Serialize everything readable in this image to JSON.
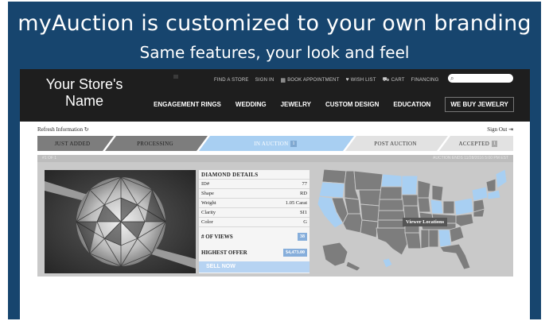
{
  "slide": {
    "headline": "myAuction is customized to your own branding",
    "subheadline": "Same features, your look and feel"
  },
  "header": {
    "store_name_line1": "Your Store's",
    "store_name_line2": "Name",
    "utility_links": [
      "FIND A STORE",
      "SIGN IN",
      "BOOK APPOINTMENT",
      "WISH LIST",
      "CART",
      "FINANCING"
    ],
    "search_placeholder": ""
  },
  "main_nav": {
    "items": [
      "ENGAGEMENT RINGS",
      "WEDDING",
      "JEWELRY",
      "CUSTOM DESIGN",
      "EDUCATION"
    ],
    "cta": "WE BUY JEWELRY"
  },
  "subbar": {
    "refresh_label": "Refresh Information",
    "signout_label": "Sign Out"
  },
  "steps": [
    {
      "label": "JUST ADDED",
      "badge": "",
      "state": "done"
    },
    {
      "label": "PROCESSING",
      "badge": "",
      "state": "done"
    },
    {
      "label": "IN AUCTION",
      "badge": "1",
      "state": "active"
    },
    {
      "label": "POST AUCTION",
      "badge": "",
      "state": "pending"
    },
    {
      "label": "ACCEPTED",
      "badge": "1",
      "state": "pending"
    }
  ],
  "panel": {
    "count_label": "#1 OF 1",
    "time_label": "AUCTION ENDS 11/28/2016 5:00 PM EST"
  },
  "details": {
    "title": "DIAMOND DETAILS",
    "rows": [
      {
        "label": "ID#",
        "value": "77"
      },
      {
        "label": "Shape",
        "value": "RD"
      },
      {
        "label": "Weight",
        "value": "1.05 Carat"
      },
      {
        "label": "Clarity",
        "value": "SI1"
      },
      {
        "label": "Color",
        "value": "G"
      }
    ],
    "views_label": "# OF VIEWS",
    "views_value": "38",
    "offer_label": "HIGHEST OFFER",
    "offer_value": "$4,473.00",
    "sell_label": "SELL NOW"
  },
  "map": {
    "tooltip": "Viewer Locations"
  },
  "colors": {
    "banner": "#17456e",
    "topnav": "#1e1e1e",
    "accent": "#86aedb",
    "highlight_state": "#a8cff2",
    "plain_state": "#7d7d7d"
  }
}
